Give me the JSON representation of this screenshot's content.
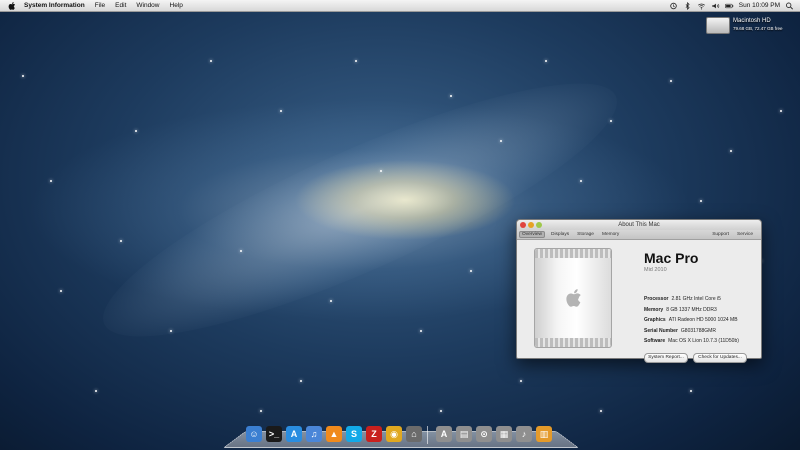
{
  "menubar": {
    "app_name": "System Information",
    "items": [
      "File",
      "Edit",
      "Window",
      "Help"
    ],
    "clock": "Sun 10:09 PM"
  },
  "desktop": {
    "disk_name": "Macintosh HD",
    "disk_info": "79.68 GB, 72.47 GB free"
  },
  "about_window": {
    "title": "About This Mac",
    "tabs": [
      "Overview",
      "Displays",
      "Storage",
      "Memory"
    ],
    "right_tabs": [
      "Support",
      "Service"
    ],
    "model": "Mac Pro",
    "model_year": "Mid 2010",
    "specs": [
      {
        "label": "Processor",
        "value": "2.81 GHz Intel Core i5"
      },
      {
        "label": "Memory",
        "value": "8 GB 1337 MHz DDR3"
      },
      {
        "label": "Graphics",
        "value": "ATI Radeon HD 5000 1024 MB"
      },
      {
        "label": "Serial Number",
        "value": "G8031788GMR"
      },
      {
        "label": "Software",
        "value": "Mac OS X Lion 10.7.3 (11D50b)"
      }
    ],
    "buttons": {
      "system_report": "System Report...",
      "check_updates": "Check for Updates..."
    }
  },
  "dock": {
    "apps": [
      {
        "name": "finder-icon",
        "color": "#3b7fd1",
        "glyph": "☺"
      },
      {
        "name": "terminal-icon",
        "color": "#1a1a1a",
        "glyph": ">_"
      },
      {
        "name": "app-store-icon",
        "color": "#2a8de0",
        "glyph": "A"
      },
      {
        "name": "itunes-icon",
        "color": "#4a86d8",
        "glyph": "♫"
      },
      {
        "name": "vlc-icon",
        "color": "#f08a1c",
        "glyph": "▲"
      },
      {
        "name": "skype-icon",
        "color": "#12a9e8",
        "glyph": "S"
      },
      {
        "name": "filezilla-icon",
        "color": "#c8201e",
        "glyph": "Z"
      },
      {
        "name": "chrome-icon",
        "color": "#e0a820",
        "glyph": "◉"
      },
      {
        "name": "system-info-icon",
        "color": "#6b6b6b",
        "glyph": "⌂"
      }
    ],
    "stacks": [
      {
        "name": "applications-stack-icon",
        "color": "#8f8f8f",
        "glyph": "A"
      },
      {
        "name": "documents-stack-icon",
        "color": "#8f8f8f",
        "glyph": "▤"
      },
      {
        "name": "downloads-stack-icon",
        "color": "#8f8f8f",
        "glyph": "⊙"
      },
      {
        "name": "pictures-stack-icon",
        "color": "#8f8f8f",
        "glyph": "▦"
      },
      {
        "name": "music-stack-icon",
        "color": "#8f8f8f",
        "glyph": "♪"
      },
      {
        "name": "trash-icon",
        "color": "#e49a2a",
        "glyph": "▥"
      }
    ]
  }
}
